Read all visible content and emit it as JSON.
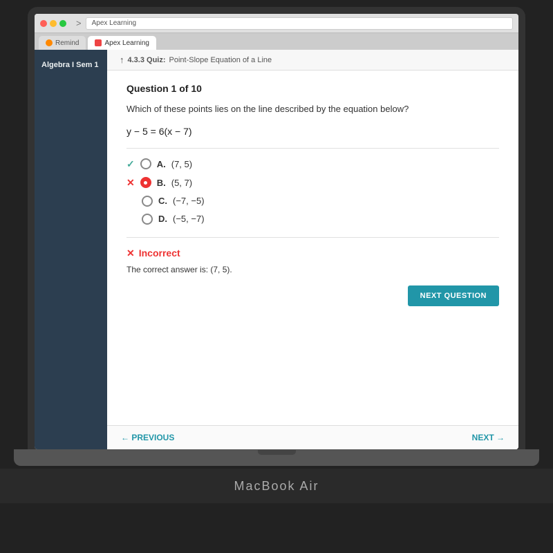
{
  "browser": {
    "tab_active_label": "Apex Learning",
    "tab_remind_label": "Remind",
    "favicon_alt": "Apex"
  },
  "sidebar": {
    "title": "Algebra I Sem 1",
    "items": []
  },
  "quiz": {
    "breadcrumb_arrow": "↑",
    "breadcrumb_label": "4.3.3 Quiz:",
    "breadcrumb_sub": "Point-Slope Equation of a Line",
    "question_number": "Question 1 of 10",
    "question_text": "Which of these points lies on the line described by the equation below?",
    "equation": "y − 5 = 6(x − 7)",
    "options": [
      {
        "letter": "A.",
        "text": "(7, 5)",
        "state": "correct"
      },
      {
        "letter": "B.",
        "text": "(5, 7)",
        "state": "wrong_selected"
      },
      {
        "letter": "C.",
        "text": "(−7, −5)",
        "state": "normal"
      },
      {
        "letter": "D.",
        "text": "(−5, −7)",
        "state": "normal"
      }
    ],
    "result_x": "✕",
    "result_label": "Incorrect",
    "correct_answer_text": "The correct answer is: (7, 5).",
    "next_button_label": "NEXT QUESTION",
    "prev_label": "← PREVIOUS",
    "next_label": "NEXT →"
  },
  "macbook_label": "MacBook Air"
}
